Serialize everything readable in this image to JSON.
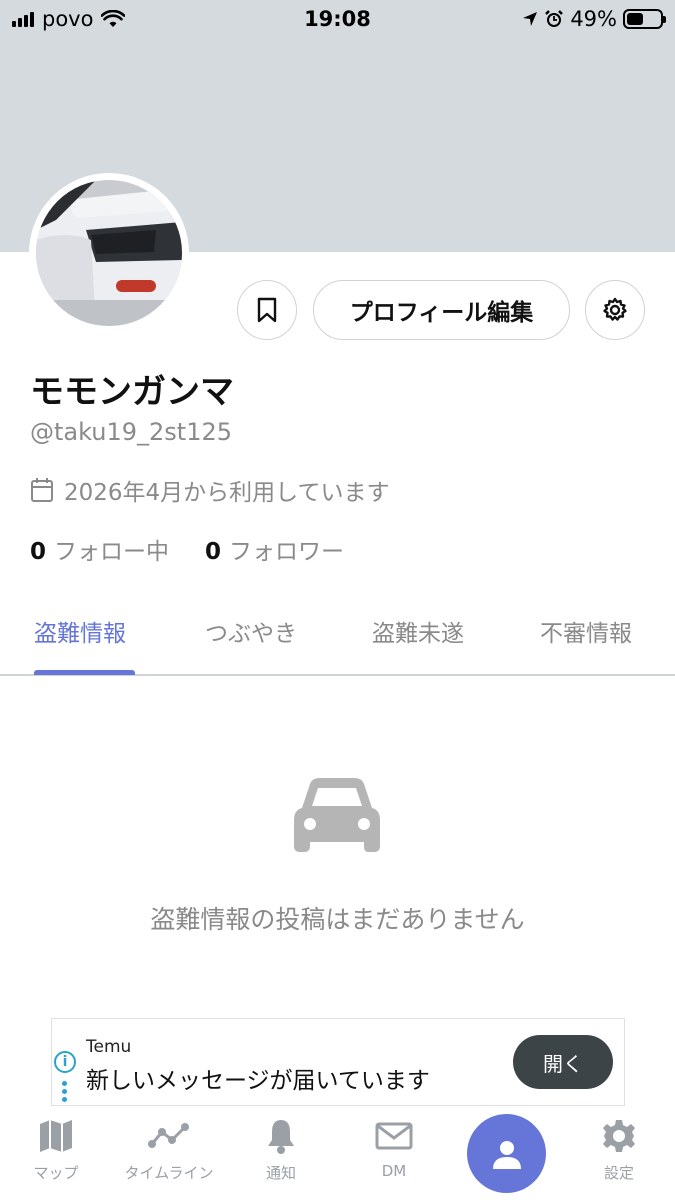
{
  "status_bar": {
    "carrier": "povo",
    "time": "19:08",
    "battery_percent": "49%",
    "battery_level": 0.49
  },
  "profile": {
    "display_name": "モモンガンマ",
    "handle": "@taku19_2st125",
    "joined": "2026年4月から利用しています",
    "following_count": "0",
    "following_label": "フォロー中",
    "followers_count": "0",
    "followers_label": "フォロワー",
    "edit_button": "プロフィール編集"
  },
  "tabs": [
    {
      "label": "盗難情報",
      "active": true
    },
    {
      "label": "つぶやき",
      "active": false
    },
    {
      "label": "盗難未遂",
      "active": false
    },
    {
      "label": "不審情報",
      "active": false
    }
  ],
  "empty_state": {
    "icon": "car-icon",
    "text": "盗難情報の投稿はまだありません"
  },
  "ad": {
    "brand": "Temu",
    "message": "新しいメッセージが届いています",
    "button": "開く"
  },
  "bottom_nav": [
    {
      "label": "マップ",
      "icon": "map-icon"
    },
    {
      "label": "タイムライン",
      "icon": "timeline-icon"
    },
    {
      "label": "通知",
      "icon": "bell-icon"
    },
    {
      "label": "DM",
      "icon": "mail-icon"
    },
    {
      "label": "",
      "icon": "profile-icon"
    },
    {
      "label": "設定",
      "icon": "gear-icon"
    }
  ],
  "colors": {
    "accent": "#6576d8",
    "banner": "#d5dadf",
    "muted_text": "#8a8a8a"
  }
}
